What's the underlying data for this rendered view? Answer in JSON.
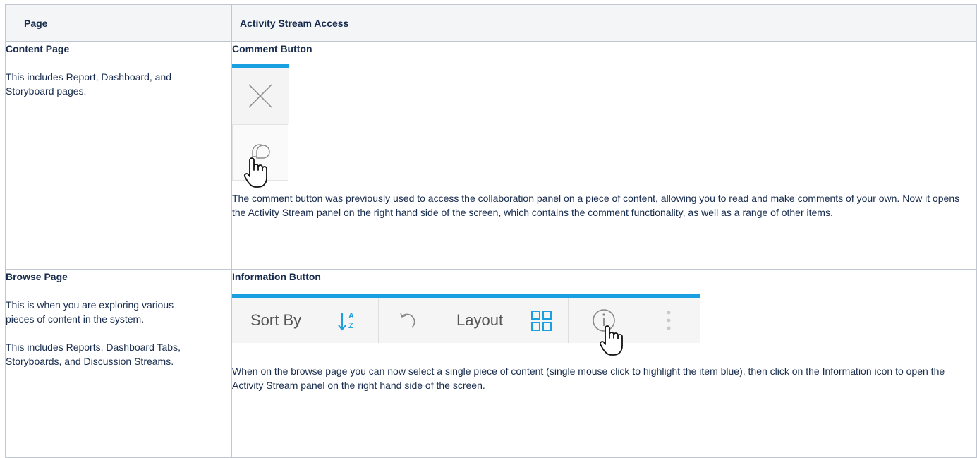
{
  "table": {
    "headers": {
      "page": "Page",
      "access": "Activity Stream Access"
    },
    "rows": [
      {
        "page_title": "Content Page",
        "page_desc": "This includes Report, Dashboard, and Storyboard pages.",
        "access_title": "Comment Button",
        "access_desc": "The comment button was previously used to access the collaboration panel on a piece of content, allowing you to read and make comments of your own. Now it opens the Activity Stream panel on the right hand side of the screen, which contains the comment functionality, as well as a range of other items."
      },
      {
        "page_title": "Browse Page",
        "page_desc": "This is when you are exploring various pieces of content in the system.",
        "page_desc2": "This includes Reports, Dashboard Tabs, Storyboards, and Discussion Streams.",
        "access_title": "Information Button",
        "access_desc": "When on the browse page you can now select a single piece of content (single mouse click to highlight the item blue), then click on the Information icon to open the Activity Stream panel on the right hand side of the screen."
      }
    ]
  },
  "toolbar": {
    "sort_label": "Sort By",
    "layout_label": "Layout"
  },
  "colors": {
    "accent": "#1a9fe0",
    "header_bg": "#f4f5f7",
    "border": "#c1c7d0"
  },
  "icons": [
    "close-icon",
    "comment-icon",
    "hand-pointer-icon",
    "sort-az-icon",
    "undo-icon",
    "layout-grid-icon",
    "info-icon",
    "more-vertical-icon"
  ]
}
